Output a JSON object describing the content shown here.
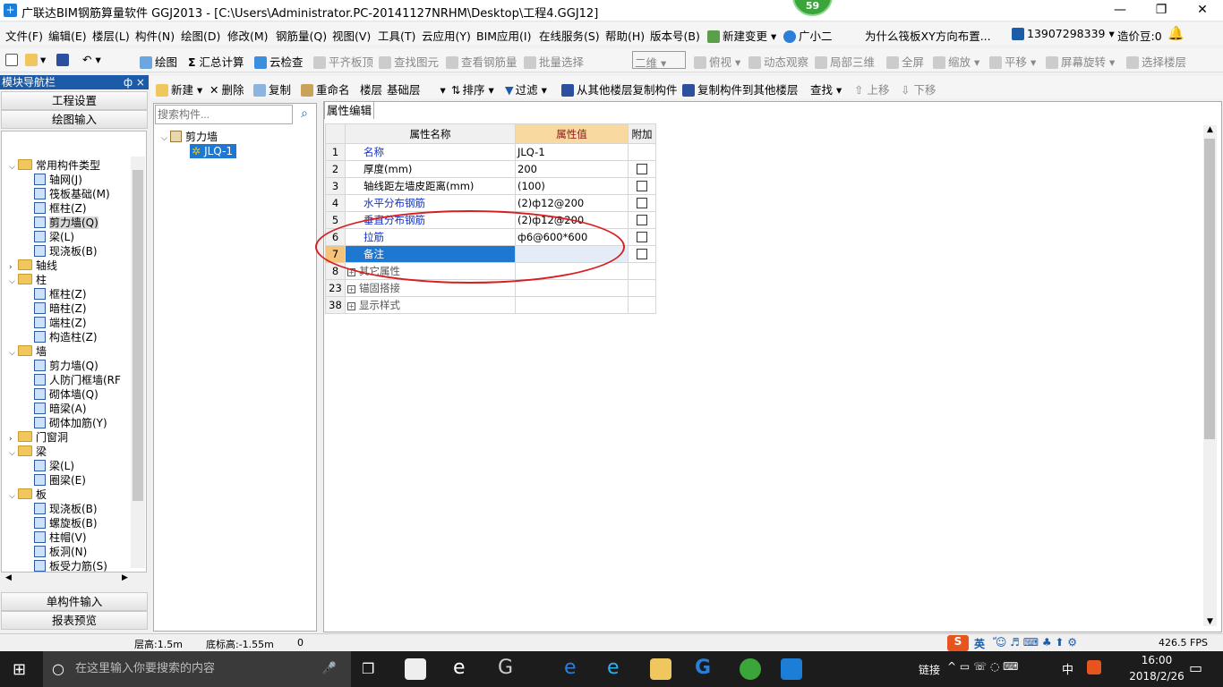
{
  "window": {
    "title": "广联达BIM钢筋算量软件 GGJ2013 - [C:\\Users\\Administrator.PC-20141127NRHM\\Desktop\\工程4.GGJ12]",
    "badge": "59",
    "min_label": "—",
    "max_label": "❐",
    "close_label": "✕"
  },
  "menu": [
    "文件(F)",
    "编辑(E)",
    "楼层(L)",
    "构件(N)",
    "绘图(D)",
    "修改(M)",
    "钢筋量(Q)",
    "视图(V)",
    "工具(T)",
    "云应用(Y)",
    "BIM应用(I)",
    "在线服务(S)",
    "帮助(H)",
    "版本号(B)",
    "新建变更",
    "广小二",
    "为什么筏板XY方向布置...",
    "13907298339",
    "造价豆:0"
  ],
  "toolbar1": {
    "draw": "绘图",
    "sum": "汇总计算",
    "cloud_check": "云检查",
    "flat_top": "平齐板顶",
    "find_elem": "查找图元",
    "view_rebar": "查看钢筋量",
    "batch_select": "批量选择",
    "view_mode": "二维",
    "top_view": "俯视",
    "dynamic": "动态观察",
    "local3d": "局部三维",
    "fullscreen": "全屏",
    "zoom": "缩放",
    "pan": "平移",
    "rotate": "屏幕旋转",
    "select_floor": "选择楼层"
  },
  "toolbar2": {
    "new": "新建",
    "delete": "删除",
    "copy": "复制",
    "rename": "重命名",
    "floor_label": "楼层",
    "floor_value": "基础层",
    "sort": "排序",
    "filter": "过滤",
    "copy_from": "从其他楼层复制构件",
    "copy_to": "复制构件到其他楼层",
    "find": "查找",
    "up": "上移",
    "down": "下移"
  },
  "left": {
    "header": "模块导航栏",
    "pin": "ф ×",
    "btn_project": "工程设置",
    "btn_draw": "绘图输入",
    "btn_single": "单构件输入",
    "btn_report": "报表预览",
    "tree": [
      {
        "label": "常用构件类型",
        "type": "folder",
        "level": 0,
        "open": true
      },
      {
        "label": "轴网(J)",
        "type": "item",
        "level": 1
      },
      {
        "label": "筏板基础(M)",
        "type": "item",
        "level": 1
      },
      {
        "label": "框柱(Z)",
        "type": "item",
        "level": 1
      },
      {
        "label": "剪力墙(Q)",
        "type": "item",
        "level": 1,
        "selected": true
      },
      {
        "label": "梁(L)",
        "type": "item",
        "level": 1
      },
      {
        "label": "现浇板(B)",
        "type": "item",
        "level": 1
      },
      {
        "label": "轴线",
        "type": "folder",
        "level": 0,
        "open": false
      },
      {
        "label": "柱",
        "type": "folder",
        "level": 0,
        "open": true
      },
      {
        "label": "框柱(Z)",
        "type": "item",
        "level": 1
      },
      {
        "label": "暗柱(Z)",
        "type": "item",
        "level": 1
      },
      {
        "label": "端柱(Z)",
        "type": "item",
        "level": 1
      },
      {
        "label": "构造柱(Z)",
        "type": "item",
        "level": 1
      },
      {
        "label": "墙",
        "type": "folder",
        "level": 0,
        "open": true
      },
      {
        "label": "剪力墙(Q)",
        "type": "item",
        "level": 1
      },
      {
        "label": "人防门框墙(RF",
        "type": "item",
        "level": 1
      },
      {
        "label": "砌体墙(Q)",
        "type": "item",
        "level": 1
      },
      {
        "label": "暗梁(A)",
        "type": "item",
        "level": 1
      },
      {
        "label": "砌体加筋(Y)",
        "type": "item",
        "level": 1
      },
      {
        "label": "门窗洞",
        "type": "folder",
        "level": 0,
        "open": false
      },
      {
        "label": "梁",
        "type": "folder",
        "level": 0,
        "open": true
      },
      {
        "label": "梁(L)",
        "type": "item",
        "level": 1
      },
      {
        "label": "圈梁(E)",
        "type": "item",
        "level": 1
      },
      {
        "label": "板",
        "type": "folder",
        "level": 0,
        "open": true
      },
      {
        "label": "现浇板(B)",
        "type": "item",
        "level": 1
      },
      {
        "label": "螺旋板(B)",
        "type": "item",
        "level": 1
      },
      {
        "label": "柱帽(V)",
        "type": "item",
        "level": 1
      },
      {
        "label": "板洞(N)",
        "type": "item",
        "level": 1
      },
      {
        "label": "板受力筋(S)",
        "type": "item",
        "level": 1
      }
    ]
  },
  "mid": {
    "search_placeholder": "搜索构件...",
    "root": "剪力墙",
    "child": "JLQ-1"
  },
  "props": {
    "tab": "属性编辑",
    "col_name": "属性名称",
    "col_value": "属性值",
    "col_extra": "附加",
    "rows": [
      {
        "n": "1",
        "name": "名称",
        "value": "JLQ-1",
        "blue": true,
        "cb": false
      },
      {
        "n": "2",
        "name": "厚度(mm)",
        "value": "200",
        "blue": false,
        "cb": true
      },
      {
        "n": "3",
        "name": "轴线距左墙皮距离(mm)",
        "value": "(100)",
        "blue": false,
        "cb": true
      },
      {
        "n": "4",
        "name": "水平分布钢筋",
        "value": "(2)ф12@200",
        "blue": true,
        "cb": true
      },
      {
        "n": "5",
        "name": "垂直分布钢筋",
        "value": "(2)ф12@200",
        "blue": true,
        "cb": true
      },
      {
        "n": "6",
        "name": "拉筋",
        "value": "ф6@600*600",
        "blue": true,
        "cb": true
      },
      {
        "n": "7",
        "name": "备注",
        "value": "",
        "blue": false,
        "cb": true,
        "selected": true
      },
      {
        "n": "8",
        "name": "其它属性",
        "value": "",
        "group": true
      },
      {
        "n": "23",
        "name": "锚固搭接",
        "value": "",
        "group": true
      },
      {
        "n": "38",
        "name": "显示样式",
        "value": "",
        "group": true
      }
    ]
  },
  "status": {
    "floor_height": "层高:1.5m",
    "base_height": "底标高:-1.55m",
    "zero": "0",
    "fps": "426.5 FPS",
    "ime": "英"
  },
  "taskbar": {
    "search_placeholder": "在这里输入你要搜索的内容",
    "link": "链接",
    "lang": "中",
    "time": "16:00",
    "date": "2018/2/26"
  }
}
